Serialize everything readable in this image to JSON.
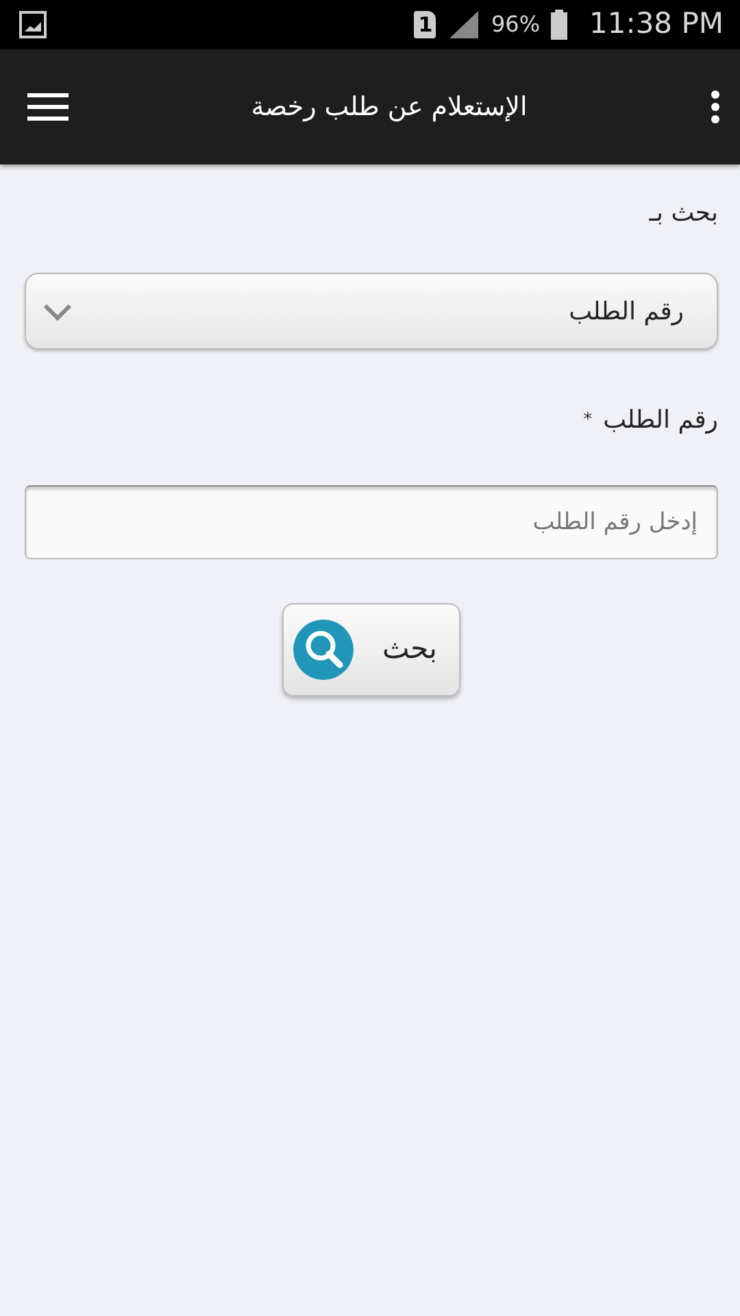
{
  "status_bar": {
    "sim_slot": "1",
    "battery": "96%",
    "time": "11:38 PM"
  },
  "app_bar": {
    "title": "الإستعلام عن طلب رخصة"
  },
  "form": {
    "search_by_label": "بحث بـ",
    "search_by_select": {
      "value": "رقم الطلب"
    },
    "request_number_label": "رقم الطلب",
    "required_mark": "*",
    "request_number_field": {
      "placeholder": "إدخل رقم الطلب"
    },
    "search_button": "بحث"
  }
}
